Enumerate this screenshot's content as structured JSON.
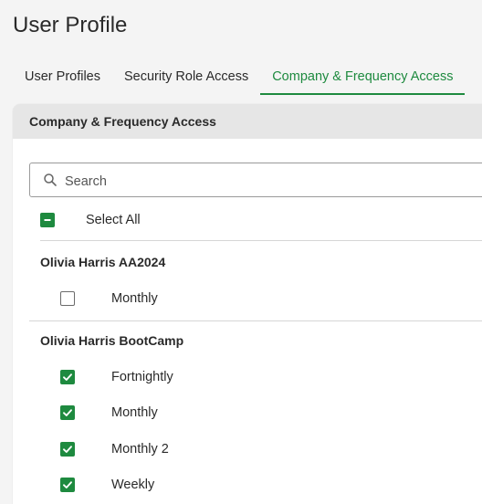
{
  "page": {
    "title": "User Profile"
  },
  "tabs": [
    {
      "label": "User Profiles",
      "active": false
    },
    {
      "label": "Security Role Access",
      "active": false
    },
    {
      "label": "Company & Frequency Access",
      "active": true
    }
  ],
  "panel": {
    "header": "Company & Frequency Access",
    "search": {
      "placeholder": "Search",
      "value": ""
    },
    "select_all": {
      "label": "Select All",
      "state": "indeterminate"
    },
    "groups": [
      {
        "name": "Olivia Harris AA2024",
        "items": [
          {
            "label": "Monthly",
            "checked": false
          }
        ]
      },
      {
        "name": "Olivia Harris BootCamp",
        "items": [
          {
            "label": "Fortnightly",
            "checked": true
          },
          {
            "label": "Monthly",
            "checked": true
          },
          {
            "label": "Monthly 2",
            "checked": true
          },
          {
            "label": "Weekly",
            "checked": true
          }
        ]
      }
    ]
  },
  "colors": {
    "accent": "#1e8a3f",
    "header_bg": "#e6e6e6",
    "page_bg": "#f4f4f4"
  }
}
